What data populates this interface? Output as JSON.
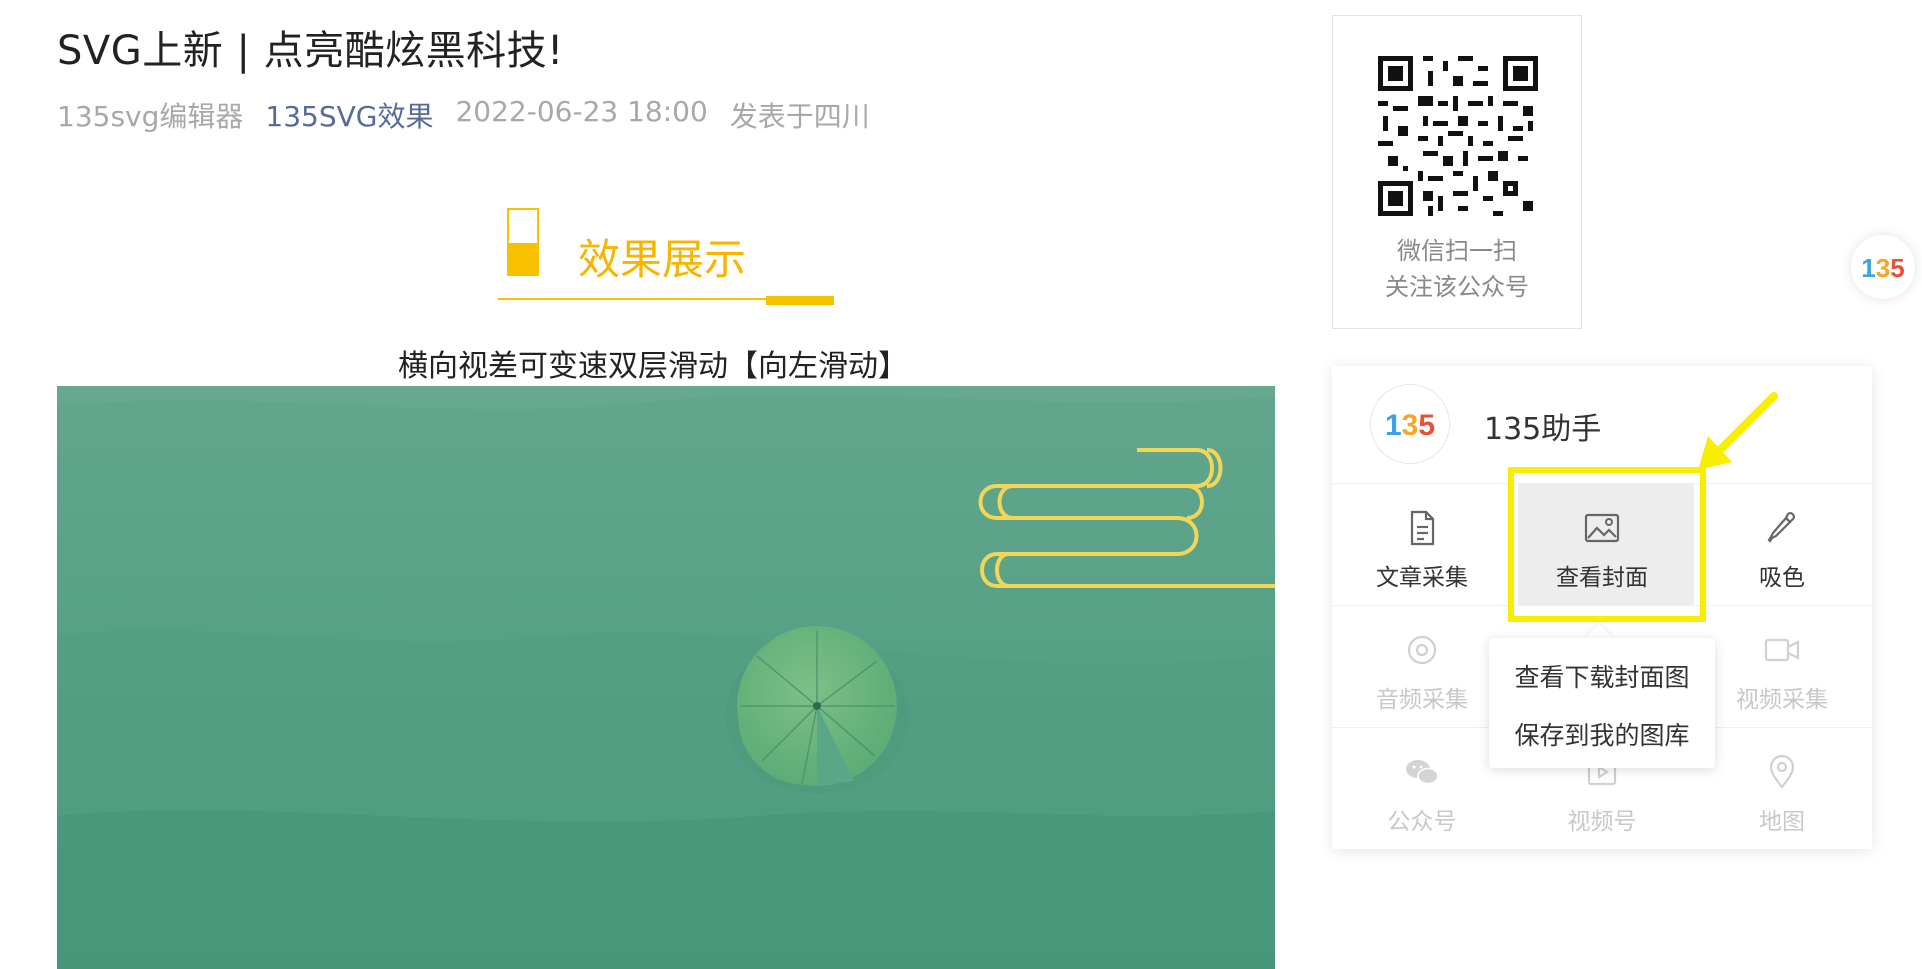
{
  "article": {
    "title": "SVG上新 | 点亮酷炫黑科技!",
    "meta": {
      "author": "135svg编辑器",
      "account": "135SVG效果",
      "datetime": "2022-06-23 18:00",
      "location": "发表于四川"
    },
    "section_title": "效果展示",
    "subtitle": "横向视差可变速双层滑动【向左滑动】"
  },
  "qr": {
    "caption_line1": "微信扫一扫",
    "caption_line2": "关注该公众号"
  },
  "float_logo": {
    "text": "135"
  },
  "helper": {
    "logo_text": "135",
    "title": "135助手",
    "tools": [
      {
        "label": "文章采集",
        "icon": "document-icon",
        "enabled": true
      },
      {
        "label": "查看封面",
        "icon": "image-icon",
        "enabled": true,
        "highlighted": true
      },
      {
        "label": "吸色",
        "icon": "eyedropper-icon",
        "enabled": true
      },
      {
        "label": "音频采集",
        "icon": "audio-icon",
        "enabled": false
      },
      {
        "label": "视频采集",
        "icon": "video-icon",
        "enabled": false
      },
      {
        "label": "公众号",
        "icon": "wechat-icon",
        "enabled": false
      },
      {
        "label": "视频号",
        "icon": "video-channel-icon",
        "enabled": false
      },
      {
        "label": "地图",
        "icon": "map-pin-icon",
        "enabled": false
      }
    ],
    "popup": {
      "items": [
        "查看下载封面图",
        "保存到我的图库"
      ]
    }
  },
  "colors": {
    "accent_yellow": "#f7c100",
    "highlight_yellow": "#f7ee00",
    "link_blue": "#576b95",
    "hero_green": "#4e9e83"
  }
}
